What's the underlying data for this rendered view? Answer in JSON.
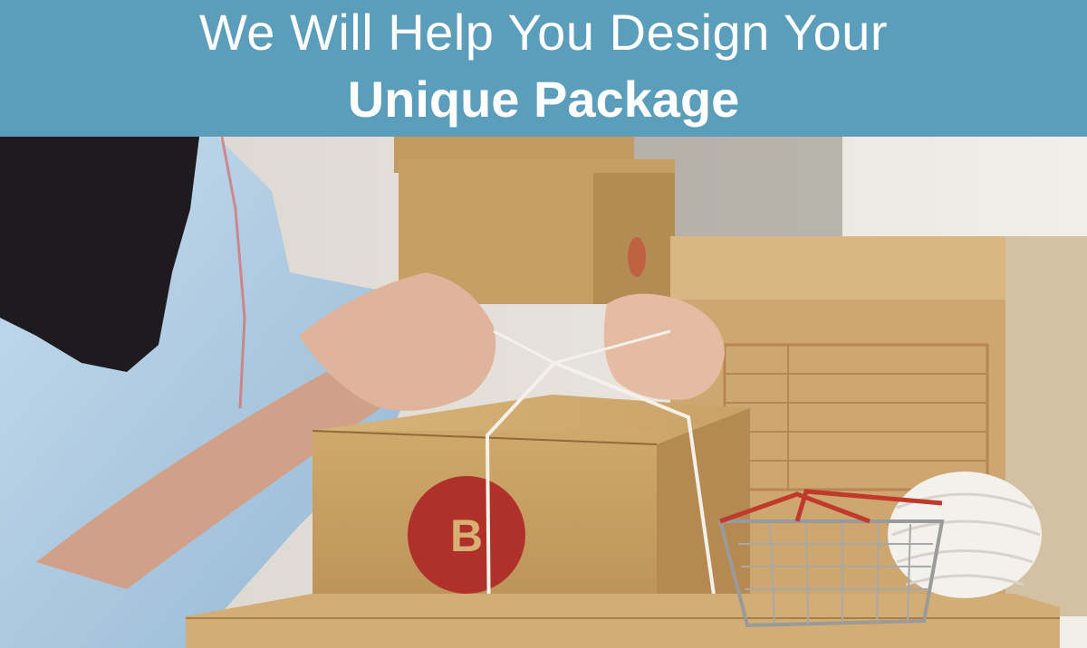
{
  "banner": {
    "line1": "We Will Help You Design Your",
    "line2": "Unique Package",
    "background": "#5a9ebc",
    "text_color": "#ffffff"
  },
  "photo": {
    "box_logo_letter": "B",
    "colors": {
      "cardboard": "#c9a266",
      "logo_red": "#b0302a",
      "shirt": "#b7d2e6",
      "wall": "#e9e2d8"
    }
  }
}
